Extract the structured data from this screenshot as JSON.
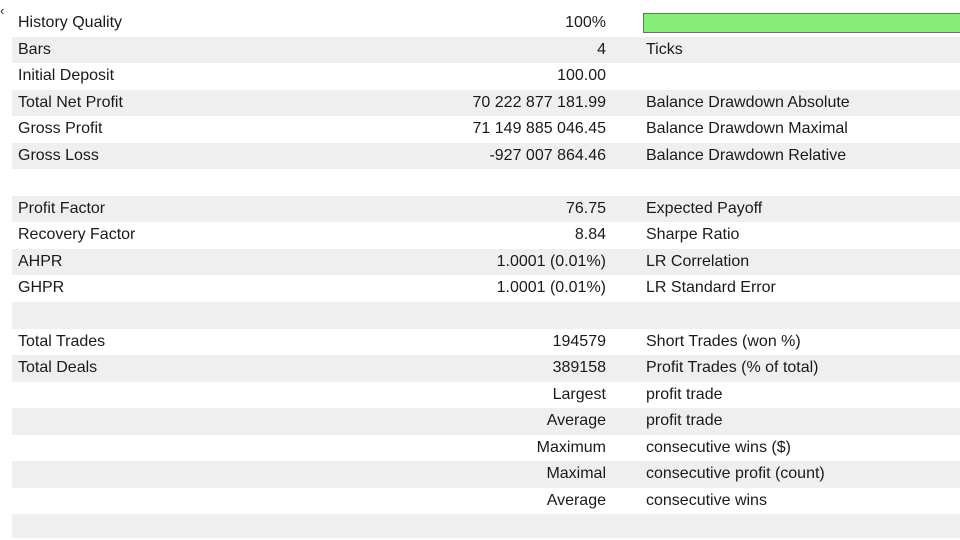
{
  "collapse_glyph": "‹",
  "history_quality": {
    "label": "History Quality",
    "value": "100%",
    "fill_fraction": 1.0,
    "bar_color": "#86ee78"
  },
  "rows": [
    {
      "label": "Bars",
      "value": "4",
      "label2": "Ticks"
    },
    {
      "label": "Initial Deposit",
      "value": "100.00",
      "label2": ""
    },
    {
      "label": "Total Net Profit",
      "value": "70 222 877 181.99",
      "label2": "Balance Drawdown Absolute"
    },
    {
      "label": "Gross Profit",
      "value": "71 149 885 046.45",
      "label2": "Balance Drawdown Maximal"
    },
    {
      "label": "Gross Loss",
      "value": "-927 007 864.46",
      "label2": "Balance Drawdown Relative"
    },
    {
      "label": "",
      "value": "",
      "label2": ""
    },
    {
      "label": "Profit Factor",
      "value": "76.75",
      "label2": "Expected Payoff"
    },
    {
      "label": "Recovery Factor",
      "value": "8.84",
      "label2": "Sharpe Ratio"
    },
    {
      "label": "AHPR",
      "value": "1.0001 (0.01%)",
      "label2": "LR Correlation"
    },
    {
      "label": "GHPR",
      "value": "1.0001 (0.01%)",
      "label2": "LR Standard Error"
    },
    {
      "label": "",
      "value": "",
      "label2": ""
    },
    {
      "label": "Total Trades",
      "value": "194579",
      "label2": "Short Trades (won %)"
    },
    {
      "label": "Total Deals",
      "value": "389158",
      "label2": "Profit Trades (% of total)"
    },
    {
      "label": "",
      "value": "Largest",
      "label2": "profit trade"
    },
    {
      "label": "",
      "value": "Average",
      "label2": "profit trade"
    },
    {
      "label": "",
      "value": "Maximum",
      "label2": "consecutive wins ($)"
    },
    {
      "label": "",
      "value": "Maximal",
      "label2": "consecutive profit (count)"
    },
    {
      "label": "",
      "value": "Average",
      "label2": "consecutive wins"
    }
  ]
}
